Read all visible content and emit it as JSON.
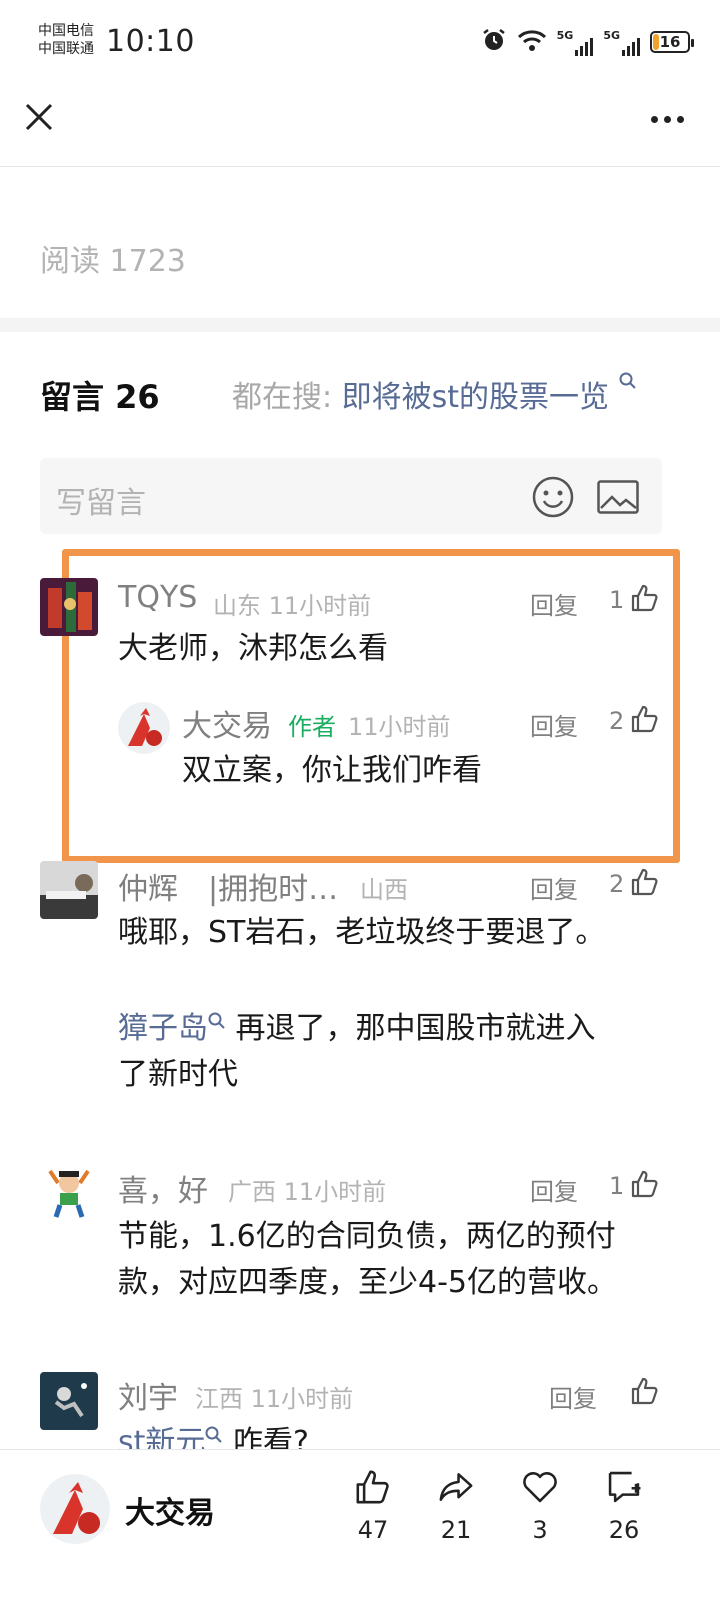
{
  "status_bar": {
    "carrier_1": "中国电信",
    "carrier_2": "中国联通",
    "time": "10:10",
    "network_1": "5G",
    "network_2": "5G",
    "battery": "16"
  },
  "nav": {
    "close_icon": "close-icon",
    "more_icon": "more-icon"
  },
  "article": {
    "read_count": "阅读 1723"
  },
  "comments_header": {
    "title": "留言 26",
    "suggest_prefix": "都在搜:",
    "suggest_link": "即将被st的股票一览"
  },
  "write_comment": {
    "placeholder": "写留言"
  },
  "comments": [
    {
      "name": "TQYS",
      "meta": "山东 11小时前",
      "reply": "回复",
      "likes": "1",
      "text": "大老师，沐邦怎么看",
      "reply_item": {
        "name": "大交易",
        "tag": "作者",
        "meta": "11小时前",
        "reply": "回复",
        "likes": "2",
        "text": "双立案，你让我们咋看"
      }
    },
    {
      "name": "仲辉　|拥抱时…",
      "meta": "山西",
      "reply": "回复",
      "likes": "2",
      "text": "哦耶，ST岩石，老垃圾终于要退了。",
      "link": "獐子岛",
      "text2_first": "再退了，那中国股市就进入",
      "text2_second": "了新时代"
    },
    {
      "name": "喜，好",
      "meta": "广西 11小时前",
      "reply": "回复",
      "likes": "1",
      "text_line1": "节能，1.6亿的合同负债，两亿的预付",
      "text_line2": "款，对应四季度，至少4-5亿的营收。"
    },
    {
      "name": "刘宇",
      "meta": "江西 11小时前",
      "reply": "回复",
      "link": "st新元",
      "text": "咋看?"
    }
  ],
  "bottom_bar": {
    "account_name": "大交易",
    "like_count": "47",
    "share_count": "21",
    "favorite_count": "3",
    "comment_count": "26"
  },
  "colors": {
    "highlight_border": "#f0954a",
    "link": "#576b95",
    "author_tag": "#1aad60",
    "battery_fill": "#f0a32c"
  }
}
